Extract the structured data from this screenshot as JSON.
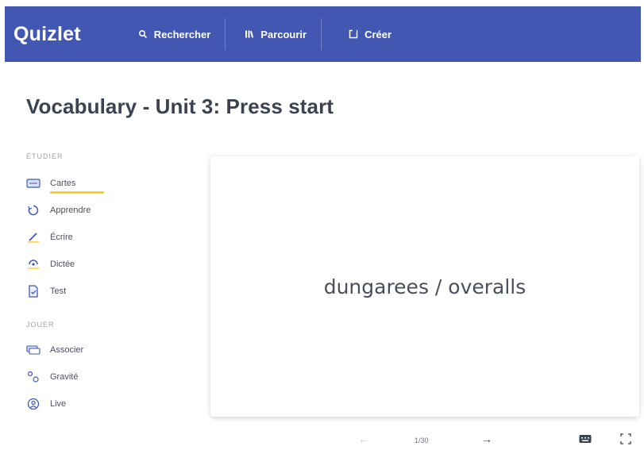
{
  "header": {
    "logo": "Quizlet",
    "nav": [
      {
        "label": "Rechercher",
        "icon": "search-icon"
      },
      {
        "label": "Parcourir",
        "icon": "library-icon"
      },
      {
        "label": "Créer",
        "icon": "create-icon"
      }
    ]
  },
  "title": "Vocabulary - Unit 3: Press start",
  "sidebar": {
    "study_label": "ÉTUDIER",
    "study_modes": [
      {
        "label": "Cartes",
        "icon": "flashcards-icon",
        "active": true
      },
      {
        "label": "Apprendre",
        "icon": "learn-icon"
      },
      {
        "label": "Écrire",
        "icon": "write-icon"
      },
      {
        "label": "Dictée",
        "icon": "spell-icon"
      },
      {
        "label": "Test",
        "icon": "test-icon"
      }
    ],
    "play_label": "JOUER",
    "play_modes": [
      {
        "label": "Associer",
        "icon": "match-icon"
      },
      {
        "label": "Gravité",
        "icon": "gravity-icon"
      },
      {
        "label": "Live",
        "icon": "live-icon"
      }
    ]
  },
  "card": {
    "term": "dungarees / overalls"
  },
  "controls": {
    "prev_icon": "←",
    "counter": "1/30",
    "next_icon": "→"
  },
  "colors": {
    "brand": "#4257b2",
    "active_underline": "#ffcd1f"
  }
}
